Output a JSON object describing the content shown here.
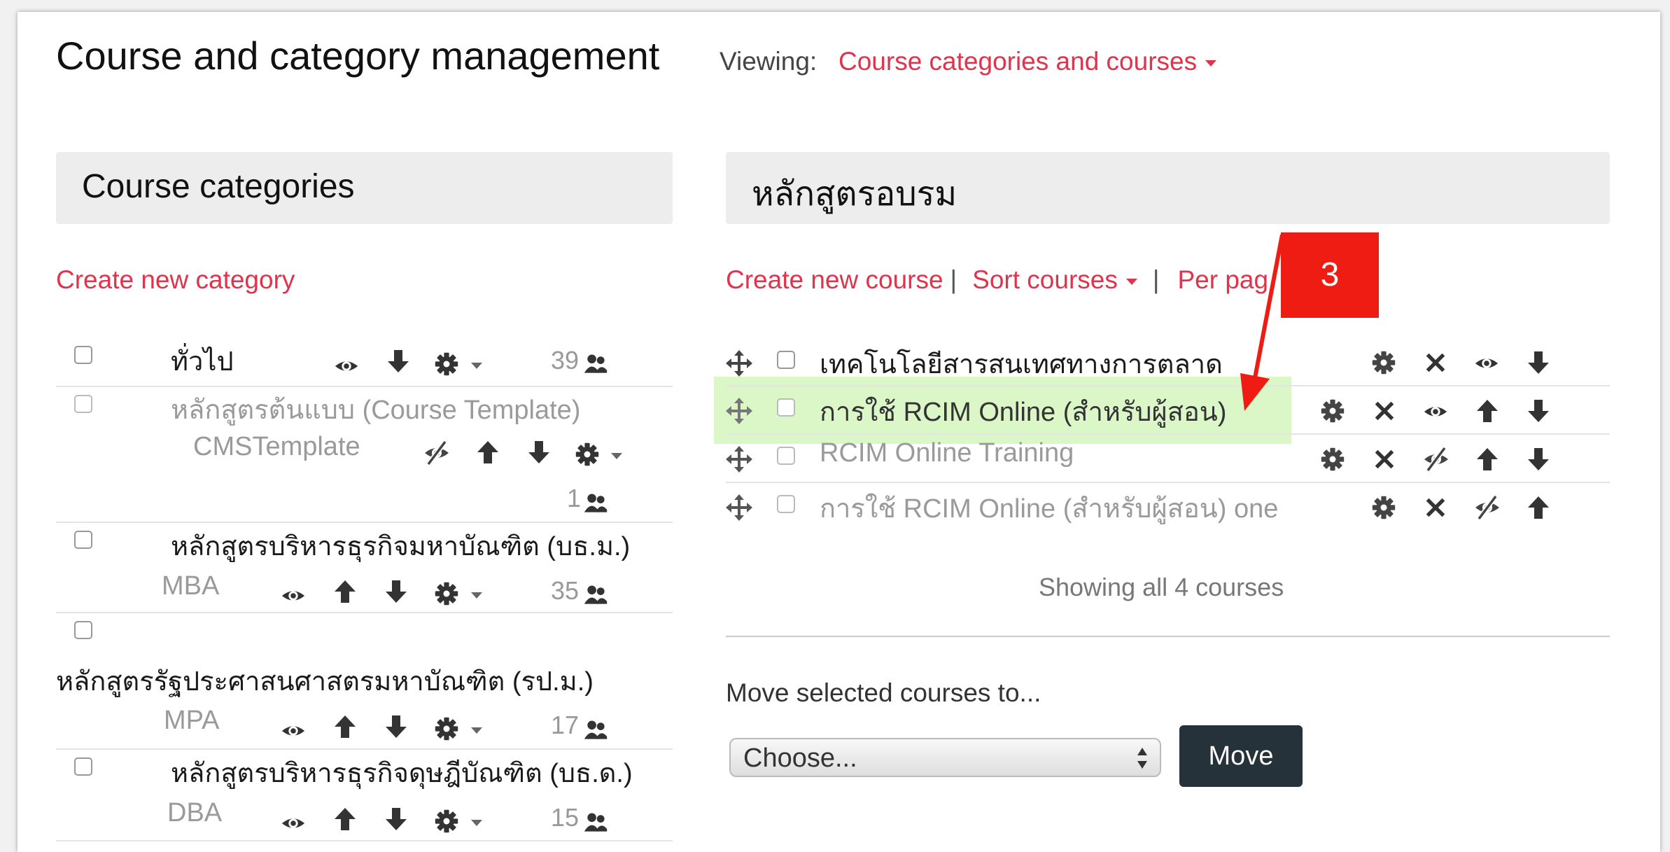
{
  "header": {
    "title": "Course and category management",
    "viewing_label": "Viewing:",
    "viewing_value": "Course categories and courses"
  },
  "categories": {
    "heading": "Course categories",
    "create_link": "Create new category",
    "items": [
      {
        "name": "ทั่วไป",
        "count": "39"
      },
      {
        "name": "หลักสูตรต้นแบบ (Course Template)",
        "idnumber": "CMSTemplate",
        "count": "1"
      },
      {
        "name": "หลักสูตรบริหารธุรกิจมหาบัณฑิต (บธ.ม.)",
        "idnumber": "MBA",
        "count": "35"
      },
      {
        "name": "หลักสูตรรัฐประศาสนศาสตรมหาบัณฑิต (รป.ม.)",
        "idnumber": "MPA",
        "count": "17"
      },
      {
        "name": "หลักสูตรบริหารธุรกิจดุษฎีบัณฑิต (บธ.ด.)",
        "idnumber": "DBA",
        "count": "15"
      }
    ]
  },
  "courses": {
    "heading": "หลักสูตรอบรม",
    "create_link": "Create new course",
    "sort_link": "Sort courses",
    "perpage_link": "Per pag",
    "separator": "|",
    "items": [
      {
        "name": "เทคโนโลยีสารสนเทศทางการตลาด"
      },
      {
        "name": "การใช้ RCIM Online (สำหรับผู้สอน)"
      },
      {
        "name": "RCIM Online Training"
      },
      {
        "name": "การใช้ RCIM Online (สำหรับผู้สอน) one"
      }
    ],
    "showing": "Showing all 4 courses",
    "move_label": "Move selected courses to...",
    "choose_placeholder": "Choose...",
    "move_button": "Move"
  },
  "annotation": {
    "number": "3",
    "color": "#ee1c12"
  },
  "colors": {
    "link": "#e0344c",
    "highlight": "#d9f6c4",
    "button": "#26323a"
  }
}
